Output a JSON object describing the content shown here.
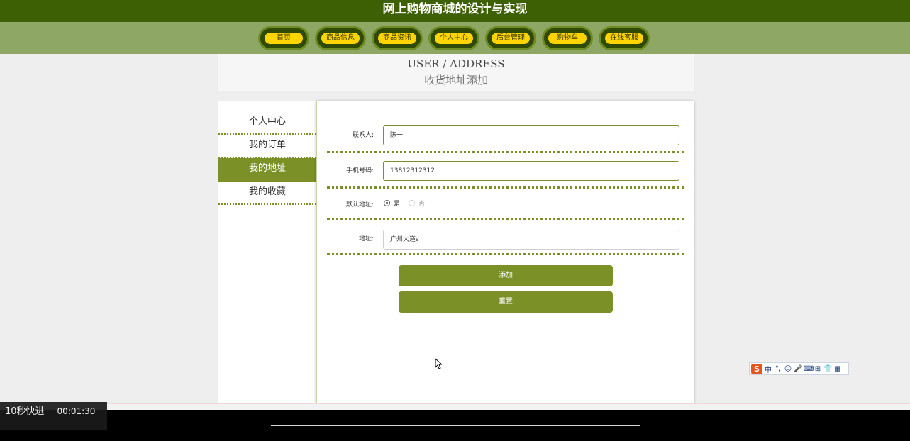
{
  "site_title": "网上购物商城的设计与实现",
  "nav": [
    "首页",
    "商品信息",
    "商品资讯",
    "个人中心",
    "后台管理",
    "购物车",
    "在线客服"
  ],
  "header": {
    "en": "USER / ADDRESS",
    "cn": "收货地址添加"
  },
  "sidebar": [
    {
      "label": "个人中心"
    },
    {
      "label": "我的订单"
    },
    {
      "label": "我的地址",
      "active": true
    },
    {
      "label": "我的收藏"
    }
  ],
  "form": {
    "contact": {
      "label": "联系人:",
      "value": "陈一"
    },
    "phone": {
      "label": "手机号码:",
      "value": "13812312312"
    },
    "default": {
      "label": "默认地址:",
      "yes": "是",
      "no": "否",
      "selected": "是"
    },
    "address": {
      "label": "地址:",
      "value": "广州大道s"
    }
  },
  "buttons": {
    "add": "添加",
    "reset": "重置"
  },
  "ime": {
    "logo": "S",
    "items": [
      "中",
      "°,",
      "☺",
      "🎤",
      "⌨",
      "⊞",
      "👕",
      "▦"
    ]
  },
  "player": {
    "skip_label": "10秒快进",
    "time": "00:01:30",
    "progress": 0.0
  },
  "colors": {
    "topbar": "#3e6005",
    "navbar": "#8fa765",
    "accent": "#7b9128",
    "nav_pill": "#ffd400"
  }
}
